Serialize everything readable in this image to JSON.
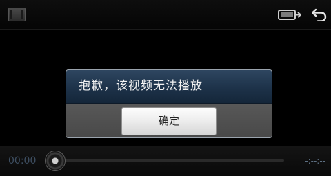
{
  "icons": {
    "thumbnail": "video-thumbnail-icon",
    "screen": "display-mode-icon",
    "back": "back-arrow-icon"
  },
  "dialog": {
    "message": "抱歉，该视频无法播放",
    "ok_label": "确定"
  },
  "player": {
    "current_time": "00:00",
    "total_time": "-:--:--",
    "progress": 0
  },
  "colors": {
    "dialog_header": "#1d3249",
    "time_text": "#3e4f62"
  }
}
